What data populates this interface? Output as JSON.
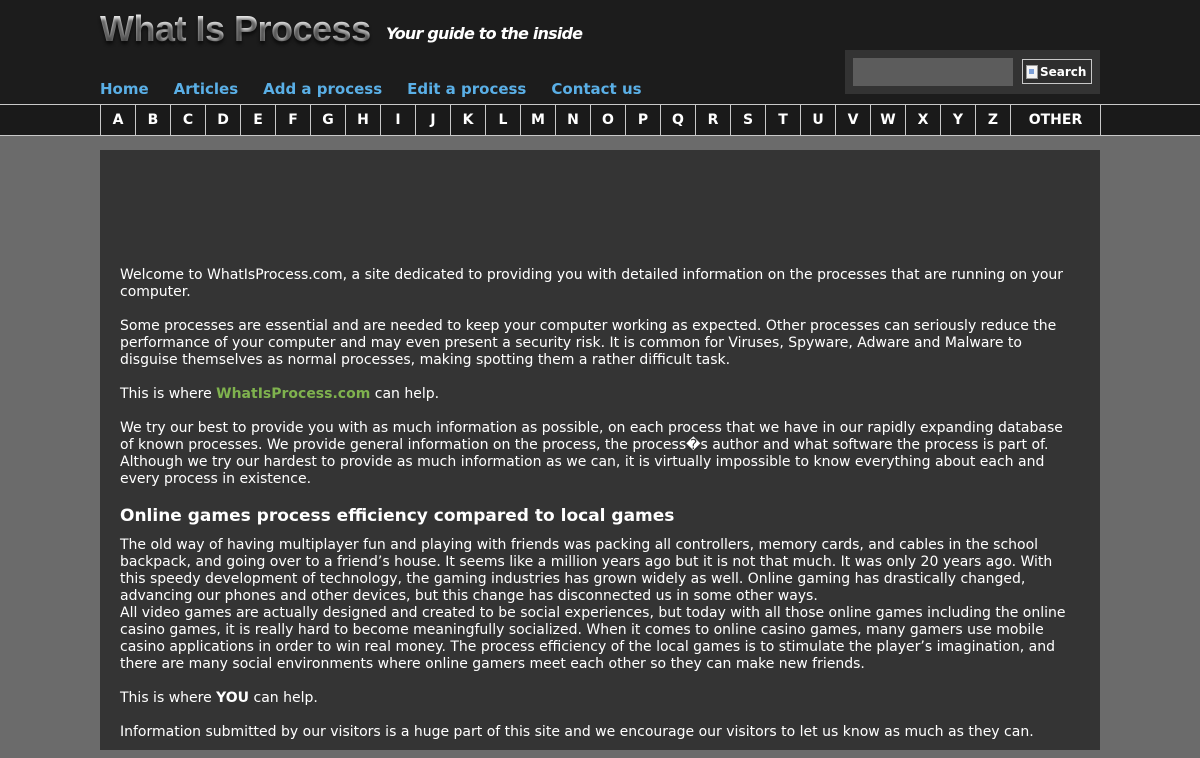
{
  "header": {
    "logo": "What Is Process",
    "tagline": "Your guide to the inside",
    "nav": [
      "Home",
      "Articles",
      "Add a process",
      "Edit a process",
      "Contact us"
    ]
  },
  "search": {
    "value": "",
    "placeholder": "",
    "button_label": "Search"
  },
  "alphabet": {
    "letters": [
      "A",
      "B",
      "C",
      "D",
      "E",
      "F",
      "G",
      "H",
      "I",
      "J",
      "K",
      "L",
      "M",
      "N",
      "O",
      "P",
      "Q",
      "R",
      "S",
      "T",
      "U",
      "V",
      "W",
      "X",
      "Y",
      "Z"
    ],
    "other": "OTHER"
  },
  "content": {
    "p1": "Welcome to WhatIsProcess.com, a site dedicated to providing you with detailed information on the processes that are running on your computer.",
    "p2": "Some processes are essential and are needed to keep your computer working as expected. Other processes can seriously reduce the performance of your computer and may even present a security risk. It is common for Viruses, Spyware, Adware and Malware to disguise themselves as normal processes, making spotting them a rather difficult task.",
    "p3_prefix": "This is where ",
    "p3_link": "WhatIsProcess.com",
    "p3_suffix": " can help.",
    "p4": "We try our best to provide you with as much information as possible, on each process that we have in our rapidly expanding database of known processes. We provide general information on the process, the process�s author and what software the process is part of. Although we try our hardest to provide as much information as we can, it is virtually impossible to know everything about each and every process in existence.",
    "heading": "Online games process efficiency compared to local games",
    "p5a": "The old way of having multiplayer fun and playing with friends was packing all controllers, memory cards, and cables in the school backpack, and going over to a friend’s house. It seems like a million years ago but it is not that much. It was only 20 years ago. With this speedy development of technology, the gaming industries has grown widely as well. Online gaming has drastically changed, advancing our phones and other devices, but this change has disconnected us in some other ways.",
    "p5b": "All video games are actually designed and created to be social experiences, but today with all those online games including the online casino games, it is really hard to become meaningfully socialized. When it comes to online casino games, many gamers use mobile casino applications in order to win real money. The process efficiency of the local games is to stimulate the player’s imagination, and there are many social environments where online gamers meet each other so they can make new friends.",
    "p6_prefix": "This is where ",
    "p6_bold": "YOU",
    "p6_suffix": " can help.",
    "p7": "Information submitted by our visitors is a huge part of this site and we encourage our visitors to let us know as much as they can."
  }
}
